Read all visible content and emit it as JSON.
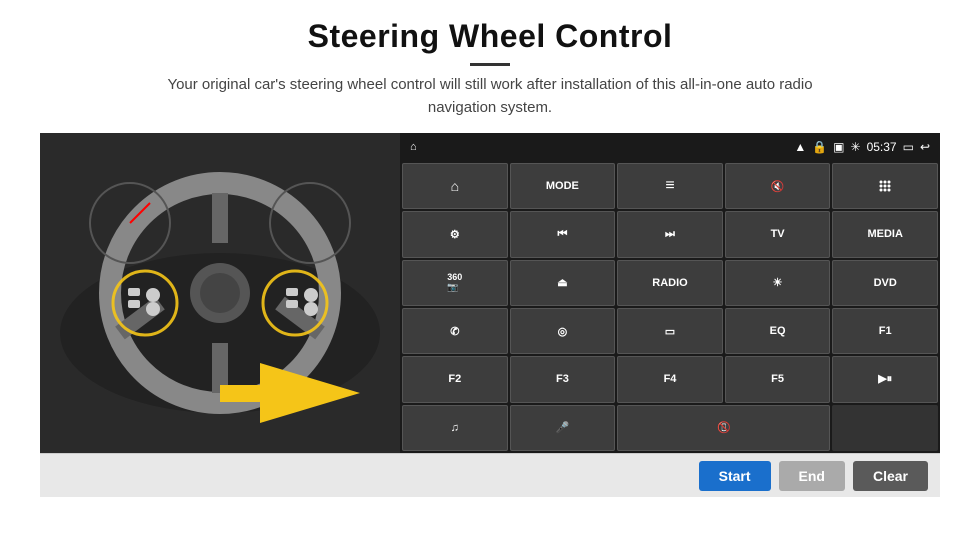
{
  "header": {
    "title": "Steering Wheel Control",
    "subtitle": "Your original car's steering wheel control will still work after installation of this all-in-one auto radio navigation system."
  },
  "status_bar": {
    "time": "05:37",
    "icons": [
      "wifi",
      "lock",
      "card",
      "bluetooth"
    ]
  },
  "button_grid": [
    {
      "id": "home",
      "type": "icon",
      "icon": "house",
      "label": "Home"
    },
    {
      "id": "mode",
      "type": "text",
      "label": "MODE"
    },
    {
      "id": "list",
      "type": "icon",
      "icon": "list",
      "label": "List"
    },
    {
      "id": "mute",
      "type": "icon",
      "icon": "mute",
      "label": "Mute"
    },
    {
      "id": "apps",
      "type": "icon",
      "icon": "apps",
      "label": "Apps"
    },
    {
      "id": "settings",
      "type": "icon",
      "icon": "settings",
      "label": "Settings"
    },
    {
      "id": "prev",
      "type": "icon",
      "icon": "prev",
      "label": "Previous"
    },
    {
      "id": "next",
      "type": "icon",
      "icon": "next",
      "label": "Next"
    },
    {
      "id": "tv",
      "type": "text",
      "label": "TV"
    },
    {
      "id": "media",
      "type": "text",
      "label": "MEDIA"
    },
    {
      "id": "360",
      "type": "text",
      "label": "360"
    },
    {
      "id": "eject",
      "type": "icon",
      "icon": "eject",
      "label": "Eject"
    },
    {
      "id": "radio",
      "type": "text",
      "label": "RADIO"
    },
    {
      "id": "brightness",
      "type": "icon",
      "icon": "sun",
      "label": "Brightness"
    },
    {
      "id": "dvd",
      "type": "text",
      "label": "DVD"
    },
    {
      "id": "phone",
      "type": "icon",
      "icon": "phone",
      "label": "Phone"
    },
    {
      "id": "nav",
      "type": "icon",
      "icon": "nav",
      "label": "Navigation"
    },
    {
      "id": "screen",
      "type": "icon",
      "icon": "screen",
      "label": "Screen"
    },
    {
      "id": "eq",
      "type": "text",
      "label": "EQ"
    },
    {
      "id": "f1",
      "type": "text",
      "label": "F1"
    },
    {
      "id": "f2",
      "type": "text",
      "label": "F2"
    },
    {
      "id": "f3",
      "type": "text",
      "label": "F3"
    },
    {
      "id": "f4",
      "type": "text",
      "label": "F4"
    },
    {
      "id": "f5",
      "type": "text",
      "label": "F5"
    },
    {
      "id": "play-pause",
      "type": "icon",
      "icon": "play-pause",
      "label": "Play/Pause"
    },
    {
      "id": "music",
      "type": "icon",
      "icon": "music",
      "label": "Music"
    },
    {
      "id": "mic",
      "type": "icon",
      "icon": "mic",
      "label": "Microphone"
    },
    {
      "id": "phone-end",
      "type": "icon",
      "icon": "phone-end",
      "label": "Phone End"
    }
  ],
  "action_bar": {
    "start_label": "Start",
    "end_label": "End",
    "clear_label": "Clear"
  }
}
